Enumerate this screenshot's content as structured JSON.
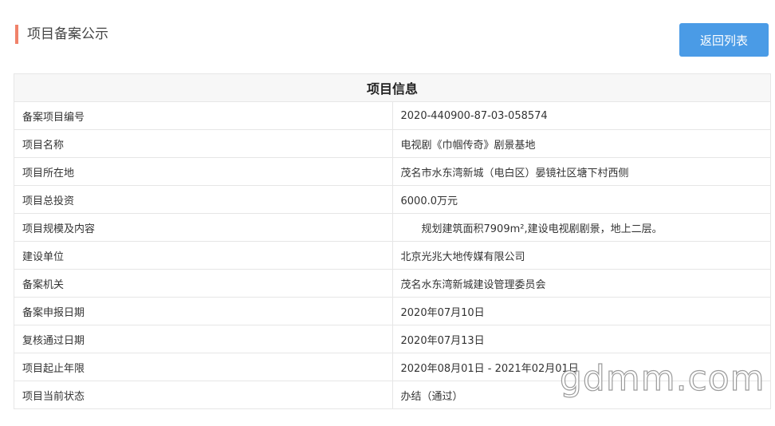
{
  "header": {
    "page_title": "项目备案公示",
    "back_button_label": "返回列表"
  },
  "table": {
    "heading": "项目信息",
    "rows": [
      {
        "label": "备案项目编号",
        "value": "2020-440900-87-03-058574"
      },
      {
        "label": "项目名称",
        "value": "电视剧《巾帼传奇》剧景基地"
      },
      {
        "label": "项目所在地",
        "value": "茂名市水东湾新城（电白区）晏镜社区塘下村西侧"
      },
      {
        "label": "项目总投资",
        "value": "6000.0万元"
      },
      {
        "label": "项目规模及内容",
        "value": "　　规划建筑面积7909m²,建设电视剧剧景，地上二层。"
      },
      {
        "label": "建设单位",
        "value": "北京光兆大地传媒有限公司"
      },
      {
        "label": "备案机关",
        "value": "茂名水东湾新城建设管理委员会"
      },
      {
        "label": "备案申报日期",
        "value": "2020年07月10日"
      },
      {
        "label": "复核通过日期",
        "value": "2020年07月13日"
      },
      {
        "label": "项目起止年限",
        "value": "2020年08月01日 - 2021年02月01日"
      },
      {
        "label": "项目当前状态",
        "value": "办结（通过）"
      }
    ]
  },
  "watermark": {
    "text": "gdmm.com"
  },
  "colors": {
    "accent": "#f0826a",
    "button": "#4a9be6"
  }
}
